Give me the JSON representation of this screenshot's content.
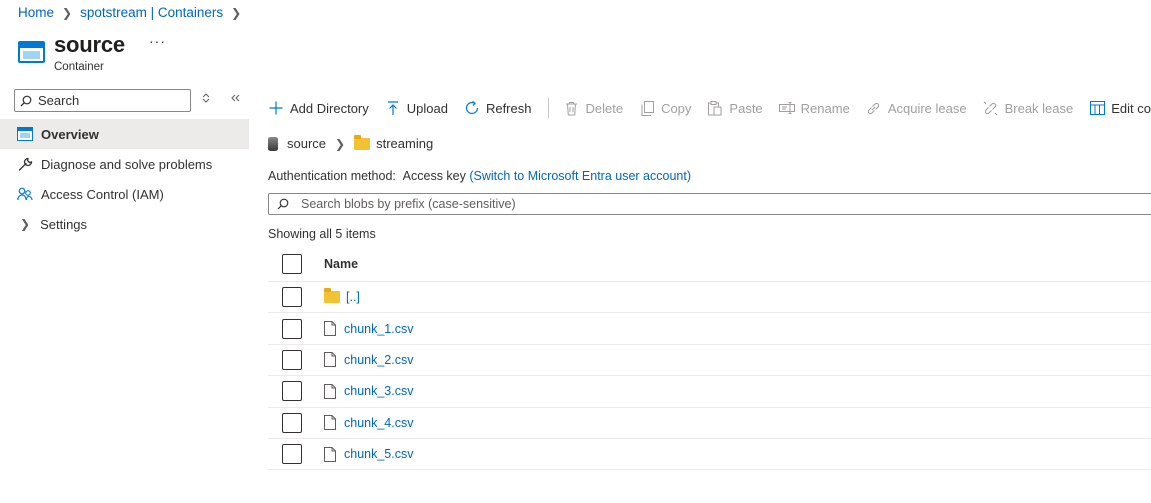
{
  "breadcrumb": [
    "Home",
    "spotstream | Containers"
  ],
  "header": {
    "title": "source",
    "subtitle": "Container",
    "more": "···"
  },
  "nav": {
    "search_placeholder": "Search",
    "items": [
      {
        "label": "Overview"
      },
      {
        "label": "Diagnose and solve problems"
      },
      {
        "label": "Access Control (IAM)"
      },
      {
        "label": "Settings"
      }
    ]
  },
  "toolbar": {
    "add_directory": "Add Directory",
    "upload": "Upload",
    "refresh": "Refresh",
    "delete": "Delete",
    "copy": "Copy",
    "paste": "Paste",
    "rename": "Rename",
    "acquire_lease": "Acquire lease",
    "break_lease": "Break lease",
    "edit_columns": "Edit columns"
  },
  "path": {
    "container": "source",
    "folder": "streaming"
  },
  "auth": {
    "label": "Authentication method:",
    "value": "Access key",
    "switch_link": "(Switch to Microsoft Entra user account)"
  },
  "blob_search": {
    "placeholder": "Search blobs by prefix (case-sensitive)"
  },
  "listing": {
    "status": "Showing all 5 items",
    "column_name": "Name",
    "parent": "[..]",
    "rows": [
      {
        "name": "chunk_1.csv"
      },
      {
        "name": "chunk_2.csv"
      },
      {
        "name": "chunk_3.csv"
      },
      {
        "name": "chunk_4.csv"
      },
      {
        "name": "chunk_5.csv"
      }
    ]
  },
  "colors": {
    "accent": "#0078d4",
    "link": "#0067b8",
    "folder": "#f2c233",
    "nav_active_bg": "#edebe9"
  }
}
